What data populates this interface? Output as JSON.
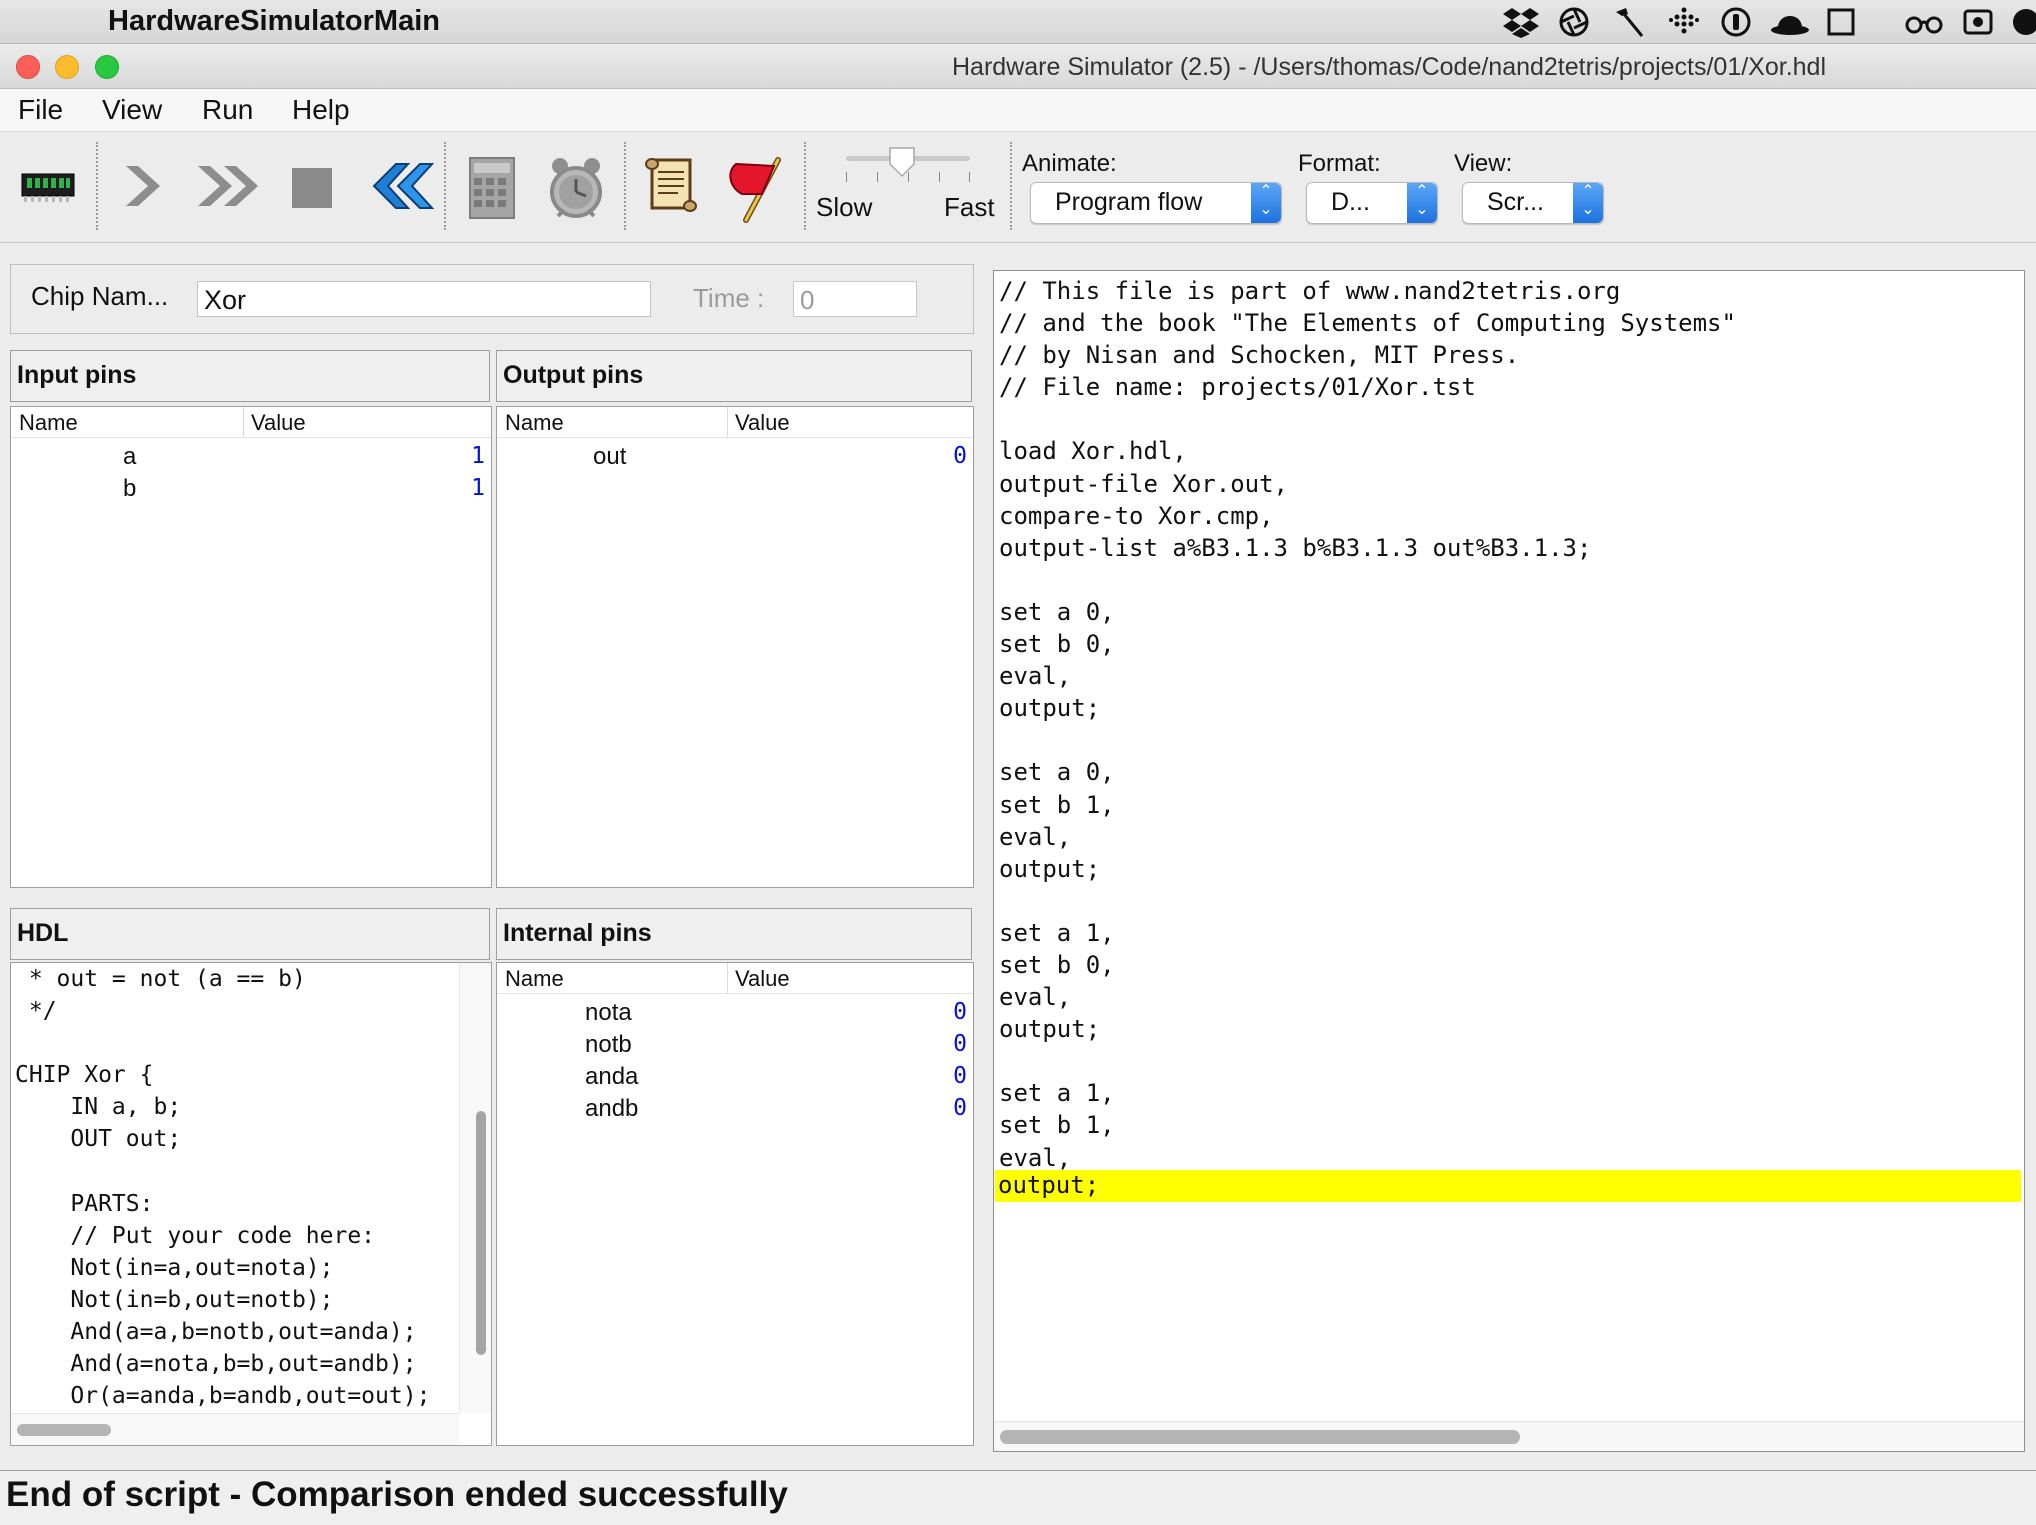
{
  "menubar": {
    "app_name": "HardwareSimulatorMain",
    "tray_icons": [
      "dropbox-icon",
      "aperture-icon",
      "hammer-icon",
      "dots-grid-icon",
      "info-icon",
      "hat-icon",
      "square-icon",
      "glasses-icon",
      "record-icon",
      "circle-icon"
    ]
  },
  "window": {
    "title": "Hardware Simulator (2.5) - /Users/thomas/Code/nand2tetris/projects/01/Xor.hdl"
  },
  "menu": {
    "items": [
      "File",
      "View",
      "Run",
      "Help"
    ]
  },
  "toolbar": {
    "buttons": [
      "chip-icon",
      "single-step-icon",
      "run-icon",
      "stop-icon",
      "reset-icon",
      "calculator-icon",
      "clock-icon",
      "script-icon",
      "breakpoint-flag-icon"
    ],
    "speed": {
      "slow_label": "Slow",
      "fast_label": "Fast",
      "level": 0.45
    },
    "animate": {
      "label": "Animate:",
      "value": "Program flow"
    },
    "format": {
      "label": "Format:",
      "value": "D..."
    },
    "view": {
      "label": "View:",
      "value": "Scr..."
    }
  },
  "chip": {
    "name_label": "Chip Nam...",
    "name_value": "Xor",
    "time_label": "Time :",
    "time_value": "0"
  },
  "input_pins": {
    "title": "Input pins",
    "col_name": "Name",
    "col_value": "Value",
    "rows": [
      {
        "name": "a",
        "value": "1"
      },
      {
        "name": "b",
        "value": "1"
      }
    ]
  },
  "output_pins": {
    "title": "Output pins",
    "col_name": "Name",
    "col_value": "Value",
    "rows": [
      {
        "name": "out",
        "value": "0"
      }
    ]
  },
  "hdl": {
    "title": "HDL",
    "code": " * out = not (a == b)\n */\n\nCHIP Xor {\n    IN a, b;\n    OUT out;\n\n    PARTS:\n    // Put your code here:\n    Not(in=a,out=nota);\n    Not(in=b,out=notb);\n    And(a=a,b=notb,out=anda);\n    And(a=nota,b=b,out=andb);\n    Or(a=anda,b=andb,out=out);"
  },
  "internal_pins": {
    "title": "Internal pins",
    "col_name": "Name",
    "col_value": "Value",
    "rows": [
      {
        "name": "nota",
        "value": "0"
      },
      {
        "name": "notb",
        "value": "0"
      },
      {
        "name": "anda",
        "value": "0"
      },
      {
        "name": "andb",
        "value": "0"
      }
    ]
  },
  "script": {
    "text": "// This file is part of www.nand2tetris.org\n// and the book \"The Elements of Computing Systems\"\n// by Nisan and Schocken, MIT Press.\n// File name: projects/01/Xor.tst\n\nload Xor.hdl,\noutput-file Xor.out,\ncompare-to Xor.cmp,\noutput-list a%B3.1.3 b%B3.1.3 out%B3.1.3;\n\nset a 0,\nset b 0,\neval,\noutput;\n\nset a 0,\nset b 1,\neval,\noutput;\n\nset a 1,\nset b 0,\neval,\noutput;\n\nset a 1,\nset b 1,\neval,",
    "highlighted_line": "output;",
    "highlight_color": "#ffff00"
  },
  "status": {
    "text": "End of script - Comparison ended successfully"
  }
}
